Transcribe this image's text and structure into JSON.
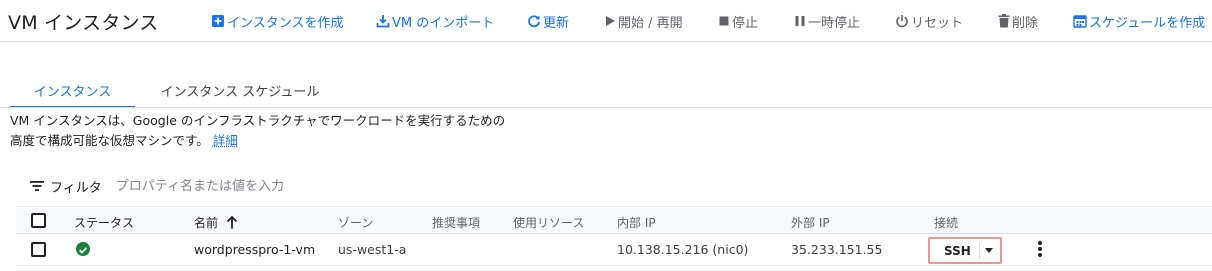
{
  "header": {
    "title": "VM インスタンス",
    "actions": [
      {
        "label": "インスタンスを作成",
        "icon": "add-box-icon",
        "state": "active"
      },
      {
        "label": "VM のインポート",
        "icon": "import-icon",
        "state": "active"
      },
      {
        "label": "更新",
        "icon": "refresh-icon",
        "state": "active"
      },
      {
        "label": "開始 / 再開",
        "icon": "play-icon",
        "state": "disabled"
      },
      {
        "label": "停止",
        "icon": "stop-icon",
        "state": "disabled"
      },
      {
        "label": "一時停止",
        "icon": "pause-icon",
        "state": "disabled"
      },
      {
        "label": "リセット",
        "icon": "power-icon",
        "state": "disabled"
      },
      {
        "label": "削除",
        "icon": "trash-icon",
        "state": "disabled"
      },
      {
        "label": "スケジュールを作成",
        "icon": "calendar-icon",
        "state": "active"
      }
    ]
  },
  "tabs": [
    {
      "label": "インスタンス",
      "selected": true
    },
    {
      "label": "インスタンス スケジュール",
      "selected": false
    }
  ],
  "description": {
    "line1": "VM インスタンスは、Google のインフラストラクチャでワークロードを実行するための",
    "line2": "高度で構成可能な仮想マシンです。",
    "link": "詳細"
  },
  "filter": {
    "label": "フィルタ",
    "placeholder": "プロパティ名または値を入力"
  },
  "table": {
    "columns": [
      "ステータス",
      "名前",
      "ゾーン",
      "推奨事項",
      "使用リソース",
      "内部 IP",
      "外部 IP",
      "接続"
    ],
    "sort_indicator": "arrow-up-icon",
    "rows": [
      {
        "status": "running",
        "name": "wordpresspro-1-vm",
        "zone": "us-west1-a",
        "recommendation": "",
        "in_use_by": "",
        "internal_ip": "10.138.15.216 (nic0)",
        "external_ip": "35.233.151.55",
        "connect": "SSH"
      }
    ]
  },
  "colors": {
    "accent": "#1a73e8",
    "status_ok": "#188038",
    "ssh_highlight": "#e8998c",
    "disabled": "#5f6368"
  }
}
